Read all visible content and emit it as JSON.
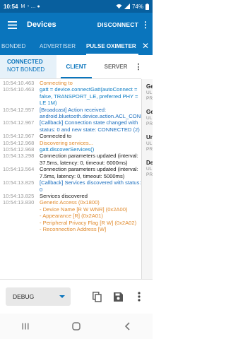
{
  "status_bar": {
    "time": "10:54",
    "notif_icons": [
      "M",
      "◔",
      "…",
      "●"
    ],
    "battery": "74%"
  },
  "app_bar": {
    "title": "Devices",
    "disconnect_label": "DISCONNECT",
    "more": "⋮"
  },
  "device_tabs": [
    {
      "label": "BONDED"
    },
    {
      "label": "ADVERTISER"
    },
    {
      "label": "PULSE OXIMETER"
    }
  ],
  "close": "✕",
  "connection": {
    "status": "CONNECTED",
    "bond": "NOT BONDED"
  },
  "sub_tabs": [
    {
      "label": "CLIENT"
    },
    {
      "label": "SERVER"
    }
  ],
  "sub_more": "⋮",
  "log": [
    {
      "ts": "10:54:10.463",
      "msg": "Connecting to",
      "level": "verbose"
    },
    {
      "ts": "10:54:10.463",
      "msg": "gatt = device.connectGatt(autoConnect = false, TRANSPORT_LE, preferred PHY = LE 1M)",
      "level": "debug"
    },
    {
      "ts": "10:54:12.957",
      "msg": "[Broadcast] Action received: android.bluetooth.device.action.ACL_CONNECTED",
      "level": "info"
    },
    {
      "ts": "10:54:12.967",
      "msg": "[Callback] Connection state changed with status: 0 and new state: CONNECTED (2)",
      "level": "info"
    },
    {
      "ts": "10:54:12.967",
      "msg": "Connected to",
      "level": "app"
    },
    {
      "ts": "10:54:12.968",
      "msg": "Discovering services...",
      "level": "verbose"
    },
    {
      "ts": "10:54:12.968",
      "msg": "gatt.discoverServices()",
      "level": "debug"
    },
    {
      "ts": "10:54:13.298",
      "msg": "Connection parameters updated (interval: 37.5ms, latency: 0, timeout: 6000ms)",
      "level": "app"
    },
    {
      "ts": "10:54:13.564",
      "msg": "Connection parameters updated (interval: 7.5ms, latency: 0, timeout: 5000ms)",
      "level": "app"
    },
    {
      "ts": "10:54:13.825",
      "msg": "[Callback] Services discovered with status: 0",
      "level": "info"
    },
    {
      "ts": "10:54:13.825",
      "msg": "Services discovered",
      "level": "app"
    },
    {
      "ts": "10:54:13.830",
      "msg": "Generic Access (0x1800)\n- Device Name [R W WNR] (0x2A00)\n- Appearance [R] (0x2A01)\n- Peripheral Privacy Flag [R W] (0x2A02)\n- Reconnection Address [W]",
      "level": "verbose"
    }
  ],
  "side_items": [
    {
      "l1": "Ge",
      "l2": "UL",
      "l3": "PR"
    },
    {
      "l1": "Ge",
      "l2": "UL",
      "l3": "PR"
    },
    {
      "l1": "Ur",
      "l2": "UL",
      "l3": "PR"
    },
    {
      "l1": "De",
      "l2": "UL",
      "l3": "PR"
    }
  ],
  "bottom": {
    "log_level": "DEBUG"
  },
  "colors": {
    "primary": "#0a75bd",
    "status_bar": "#085f9e",
    "verbose": "#e08a2c",
    "info": "#1c6fbf"
  }
}
